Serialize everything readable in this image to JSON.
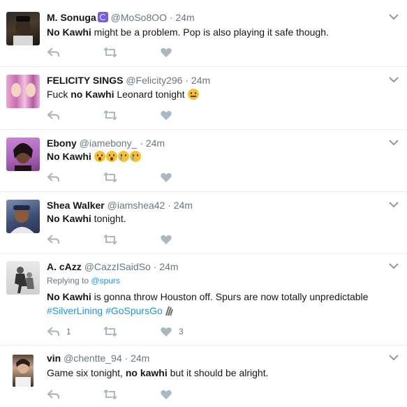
{
  "colors": {
    "text": "#14171a",
    "muted": "#657786",
    "link": "#1b95e0",
    "icon": "#aab8c2",
    "divider": "#e6ecf0"
  },
  "icons": {
    "reply": "reply-arrow-icon",
    "retweet": "retweet-icon",
    "like": "heart-icon",
    "more": "chevron-down-icon"
  },
  "tweets": [
    {
      "name": "M. Sonuga",
      "handle": "@MoSo8OO",
      "dot": "·",
      "time": "24m",
      "text_bold": "No Kawhi",
      "text_rest": " might be a problem. Pop is also playing it safe though."
    },
    {
      "name": "FELICITY SINGS",
      "handle": "@Felicity296",
      "dot": "·",
      "time": "24m",
      "text_pre": "Fuck ",
      "text_bold": "no Kawhi",
      "text_rest": " Leonard tonight"
    },
    {
      "name": "Ebony",
      "handle": "@iamebony_",
      "dot": "·",
      "time": "24m",
      "text_bold": "No Kawhi"
    },
    {
      "name": "Shea Walker",
      "handle": "@iamshea42",
      "dot": "·",
      "time": "24m",
      "text_bold": "No Kawhi",
      "text_rest": " tonight."
    },
    {
      "name": "A. cAzz",
      "handle": "@CazzISaidSo",
      "dot": "·",
      "time": "24m",
      "replying_label": "Replying to",
      "replying_to": "@spurs",
      "text_bold": "No Kawhi",
      "text_rest": " is gonna throw Houston off. Spurs are now totally unpredictable",
      "hashtag1": "#SilverLining",
      "hashtag2": "#GoSpursGo",
      "reply_count": "1",
      "like_count": "3"
    },
    {
      "name": "vin",
      "handle": "@chentte_94",
      "dot": "·",
      "time": "24m",
      "text_pre": "Game six tonight, ",
      "text_bold": "no kawhi",
      "text_rest": " but it should be alright."
    }
  ]
}
